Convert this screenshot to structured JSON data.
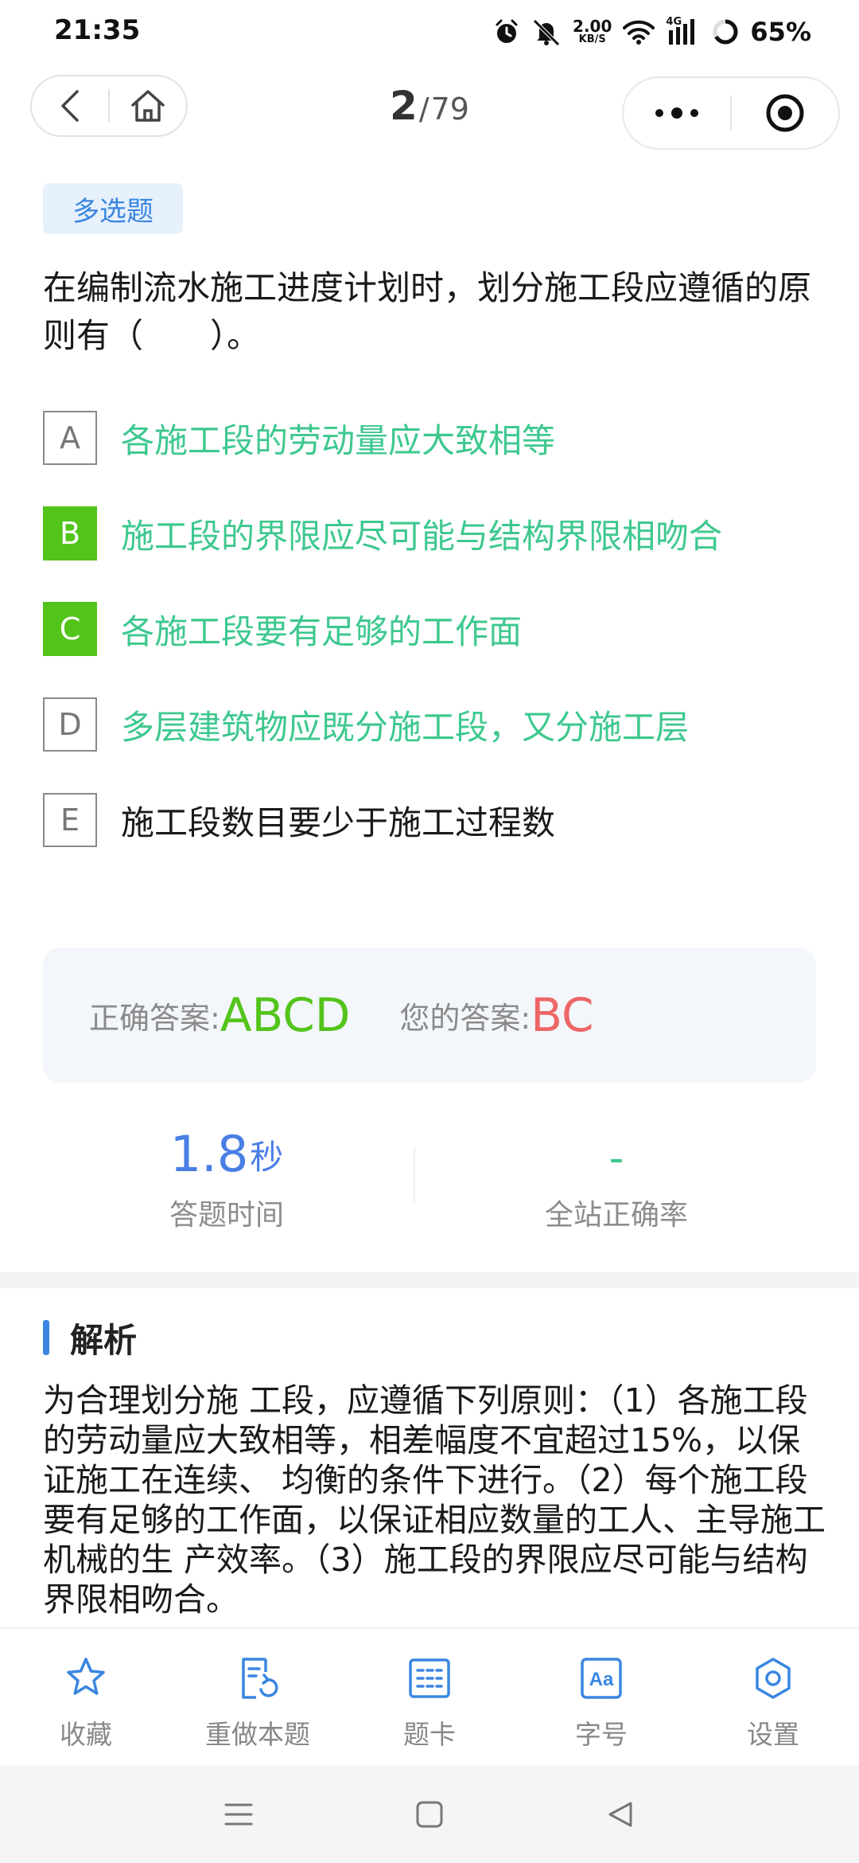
{
  "status_bar": {
    "time": "21:35",
    "net_speed_value": "2.00",
    "net_speed_unit": "KB/S",
    "network_type": "4G",
    "battery": "65%",
    "icons": [
      "alarm-icon",
      "mute-icon",
      "wifi-icon",
      "signal-icon",
      "battery-icon"
    ]
  },
  "nav": {
    "current": "2",
    "separator": "/",
    "total": "79",
    "left_buttons": [
      "back-icon",
      "home-icon"
    ],
    "right_buttons": [
      "more-icon",
      "target-icon"
    ]
  },
  "question": {
    "type_label": "多选题",
    "text": "在编制流水施工进度计划时，划分施工段应遵循的原则有（　　）。",
    "options": [
      {
        "letter": "A",
        "text": "各施工段的劳动量应大致相等",
        "selected": false,
        "correct": true
      },
      {
        "letter": "B",
        "text": "施工段的界限应尽可能与结构界限相吻合",
        "selected": true,
        "correct": true
      },
      {
        "letter": "C",
        "text": "各施工段要有足够的工作面",
        "selected": true,
        "correct": true
      },
      {
        "letter": "D",
        "text": "多层建筑物应既分施工段，又分施工层",
        "selected": false,
        "correct": true
      },
      {
        "letter": "E",
        "text": "施工段数目要少于施工过程数",
        "selected": false,
        "correct": false
      }
    ]
  },
  "answer": {
    "correct_label": "正确答案:",
    "correct_value": "ABCD",
    "yours_label": "您的答案:",
    "yours_value": "BC"
  },
  "stats": {
    "time_value": "1.8",
    "time_unit": "秒",
    "time_label": "答题时间",
    "rate_value": "-",
    "rate_label": "全站正确率"
  },
  "analysis": {
    "title": "解析",
    "text": "为合理划分施 工段，应遵循下列原则：（1）各施工段的劳动量应大致相等，相差幅度不宜超过15%，以保证施工在连续、 均衡的条件下进行。（2）每个施工段要有足够的工作面，以保证相应数量的工人、主导施工机械的生 产效率。（3）施工段的界限应尽可能与结构界限相吻合。"
  },
  "toolbar": {
    "items": [
      {
        "label": "收藏",
        "icon": "star-icon"
      },
      {
        "label": "重做本题",
        "icon": "redo-icon"
      },
      {
        "label": "题卡",
        "icon": "answer-card-icon"
      },
      {
        "label": "字号",
        "icon": "font-size-icon"
      },
      {
        "label": "设置",
        "icon": "settings-icon"
      }
    ]
  },
  "colors": {
    "accent_blue": "#3a86e0",
    "correct_green": "#3ec88e",
    "selected_green": "#52c41a",
    "wrong_red": "#ee6666"
  }
}
